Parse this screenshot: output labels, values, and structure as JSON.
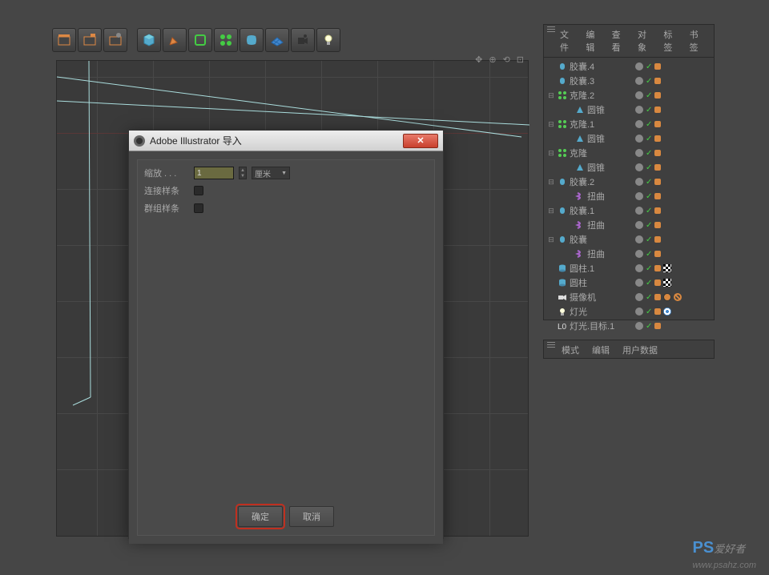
{
  "toolbar": {
    "icons": [
      "movie-clapboard",
      "movie-tag",
      "movie-gear",
      "cube-primitive",
      "pen-spline",
      "nurbs-cube",
      "array-green",
      "deformer-blue",
      "floor-grid",
      "camera",
      "light"
    ]
  },
  "viewport": {
    "icons": [
      "move-icon",
      "zoom-icon",
      "rotate-icon",
      "maximize-icon"
    ]
  },
  "dialog": {
    "title": "Adobe Illustrator 导入",
    "scale_label": "缩放 . . .",
    "scale_value": "1",
    "scale_unit": "厘米",
    "connect_label": "连接样条",
    "group_label": "群组样条",
    "ok": "确定",
    "cancel": "取消"
  },
  "obj_manager": {
    "tabs": [
      "文件",
      "编辑",
      "查看",
      "对象",
      "标签",
      "书签"
    ],
    "items": [
      {
        "name": "胶囊.4",
        "icon": "capsule",
        "color": "#5ac",
        "indent": 0,
        "exp": ""
      },
      {
        "name": "胶囊.3",
        "icon": "capsule",
        "color": "#5ac",
        "indent": 0,
        "exp": ""
      },
      {
        "name": "克隆.2",
        "icon": "cloner",
        "color": "#5c5",
        "indent": 0,
        "exp": "⊟"
      },
      {
        "name": "圆锥",
        "icon": "cone",
        "color": "#5ac",
        "indent": 1,
        "exp": ""
      },
      {
        "name": "克隆.1",
        "icon": "cloner",
        "color": "#5c5",
        "indent": 0,
        "exp": "⊟"
      },
      {
        "name": "圆锥",
        "icon": "cone",
        "color": "#5ac",
        "indent": 1,
        "exp": ""
      },
      {
        "name": "克隆",
        "icon": "cloner",
        "color": "#5c5",
        "indent": 0,
        "exp": "⊟"
      },
      {
        "name": "圆锥",
        "icon": "cone",
        "color": "#5ac",
        "indent": 1,
        "exp": ""
      },
      {
        "name": "胶囊.2",
        "icon": "capsule",
        "color": "#5ac",
        "indent": 0,
        "exp": "⊟"
      },
      {
        "name": "扭曲",
        "icon": "twist",
        "color": "#a6c",
        "indent": 1,
        "exp": ""
      },
      {
        "name": "胶囊.1",
        "icon": "capsule",
        "color": "#5ac",
        "indent": 0,
        "exp": "⊟"
      },
      {
        "name": "扭曲",
        "icon": "twist",
        "color": "#a6c",
        "indent": 1,
        "exp": ""
      },
      {
        "name": "胶囊",
        "icon": "capsule",
        "color": "#5ac",
        "indent": 0,
        "exp": "⊟"
      },
      {
        "name": "扭曲",
        "icon": "twist",
        "color": "#a6c",
        "indent": 1,
        "exp": ""
      },
      {
        "name": "圆柱.1",
        "icon": "cylinder",
        "color": "#5ac",
        "indent": 0,
        "exp": "",
        "checker": true
      },
      {
        "name": "圆柱",
        "icon": "cylinder",
        "color": "#5ac",
        "indent": 0,
        "exp": "",
        "checker": true
      },
      {
        "name": "摄像机",
        "icon": "camera",
        "color": "#ddd",
        "indent": 0,
        "exp": "",
        "prohibit": true
      },
      {
        "name": "灯光",
        "icon": "light",
        "color": "#ddd",
        "indent": 0,
        "exp": "",
        "target": true
      },
      {
        "name": "灯光.目标.1",
        "icon": "null",
        "color": "#ddd",
        "indent": 0,
        "exp": ""
      }
    ]
  },
  "attr_manager": {
    "tabs": [
      "模式",
      "编辑",
      "用户数据"
    ]
  },
  "watermark": {
    "logo": "PS",
    "text": "爱好者",
    "url": "www.psahz.com"
  }
}
